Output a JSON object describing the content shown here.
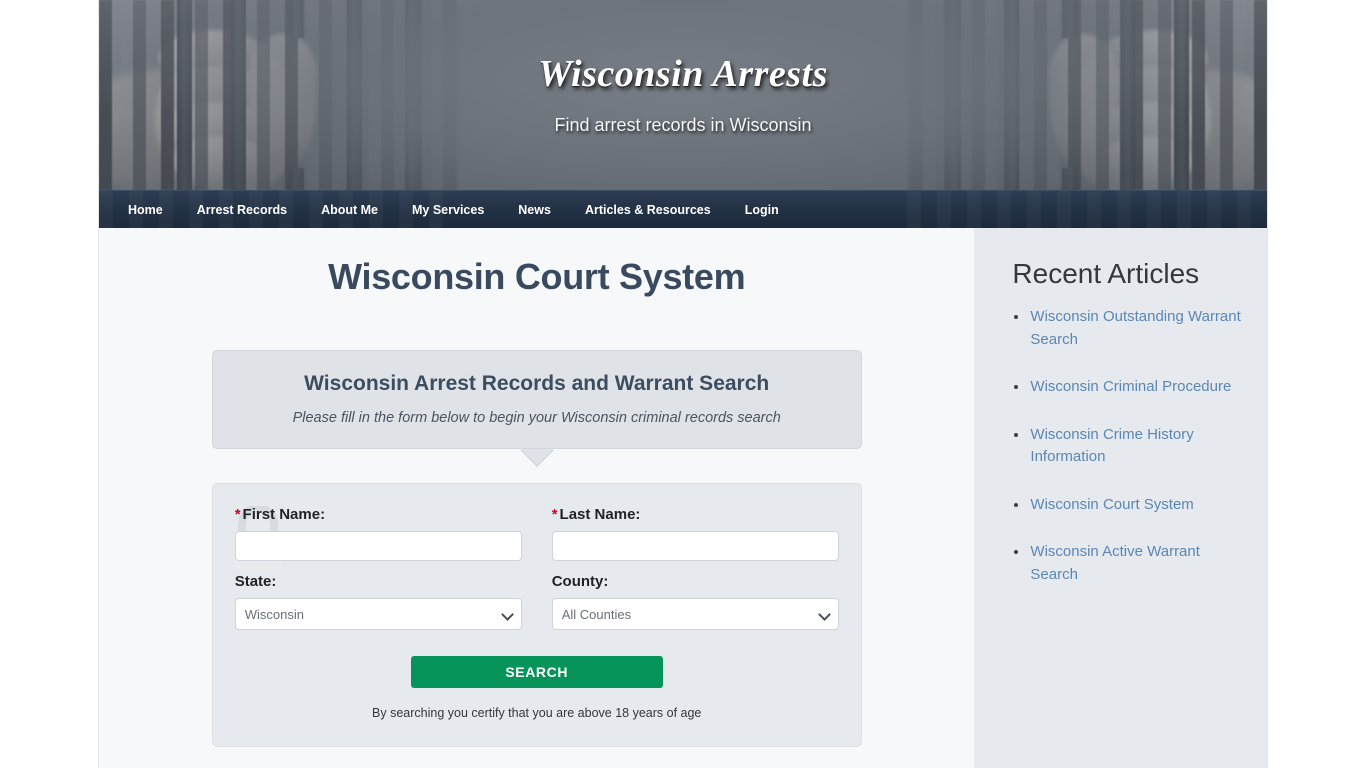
{
  "banner": {
    "title": "Wisconsin Arrests",
    "tagline": "Find arrest records in Wisconsin",
    "left_image_name": "hands-gripping-prison-bars",
    "right_image_name": "hands-gripping-prison-bars-mirrored"
  },
  "nav": {
    "items": [
      {
        "label": "Home"
      },
      {
        "label": "Arrest Records"
      },
      {
        "label": "About Me"
      },
      {
        "label": "My Services"
      },
      {
        "label": "News"
      },
      {
        "label": "Articles & Resources"
      },
      {
        "label": "Login"
      }
    ]
  },
  "main": {
    "page_title": "Wisconsin Court System",
    "callout": {
      "title": "Wisconsin Arrest Records and Warrant Search",
      "subtitle": "Please fill in the form below to begin your Wisconsin criminal records search"
    },
    "form": {
      "required_marker": "*",
      "first_name": {
        "label": "First Name:",
        "value": "",
        "placeholder": ""
      },
      "last_name": {
        "label": "Last Name:",
        "value": "",
        "placeholder": ""
      },
      "state": {
        "label": "State:",
        "selected": "Wisconsin"
      },
      "county": {
        "label": "County:",
        "selected": "All Counties"
      },
      "search_button": "SEARCH",
      "age_note": "By searching you certify that you are above 18 years of age"
    }
  },
  "sidebar": {
    "title": "Recent Articles",
    "articles": [
      {
        "label": "Wisconsin Outstanding Warrant Search"
      },
      {
        "label": "Wisconsin Criminal Procedure"
      },
      {
        "label": "Wisconsin Crime History Information"
      },
      {
        "label": "Wisconsin Court System"
      },
      {
        "label": "Wisconsin Active Warrant Search"
      }
    ]
  },
  "colors": {
    "nav_background": "#223044",
    "page_title": "#394a5e",
    "search_button": "#07945a",
    "link": "#5b87b5",
    "required_asterisk": "#d0021b",
    "sidebar_background": "#e6e9ed",
    "callout_background": "#dfe3e8"
  }
}
